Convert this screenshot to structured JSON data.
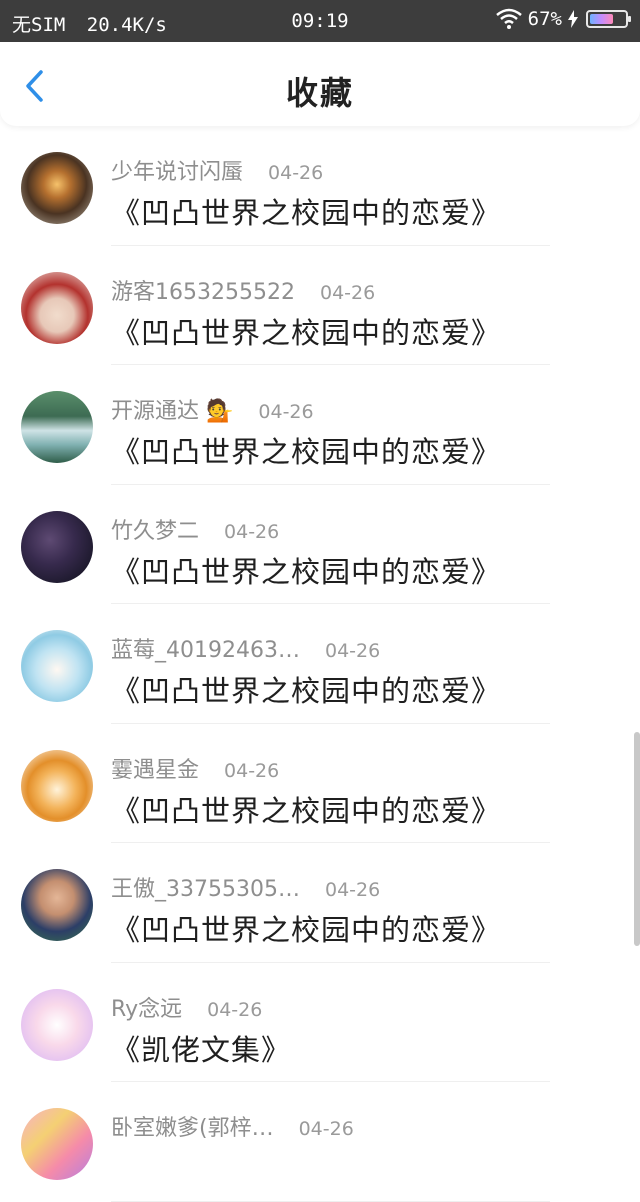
{
  "status_bar": {
    "carrier": "无SIM",
    "speed": "20.4K/s",
    "time": "09:19",
    "battery_percent": "67%",
    "battery_level": 0.67,
    "colors": {
      "background": "#3d3d3d",
      "text": "#ffffff"
    }
  },
  "header": {
    "title": "收藏",
    "back_icon": "chevron-left-icon",
    "accent_color": "#2f8fe8"
  },
  "items": [
    {
      "user": "少年说讨闪蜃",
      "date": "04-26",
      "title": "《凹凸世界之校园中的恋爱》",
      "avatar": "lantern"
    },
    {
      "user": "游客1653255522",
      "date": "04-26",
      "title": "《凹凸世界之校园中的恋爱》",
      "avatar": "red-hair"
    },
    {
      "user": "开源通达 💁",
      "date": "04-26",
      "title": "《凹凸世界之校园中的恋爱》",
      "avatar": "waterfall"
    },
    {
      "user": "竹久梦二",
      "date": "04-26",
      "title": "《凹凸世界之校园中的恋爱》",
      "avatar": "night-sky"
    },
    {
      "user": "蓝莓_40192463…",
      "date": "04-26",
      "title": "《凹凸世界之校园中的恋爱》",
      "avatar": "anime-blue"
    },
    {
      "user": "霎遇星金",
      "date": "04-26",
      "title": "《凹凸世界之校园中的恋爱》",
      "avatar": "fox-boy"
    },
    {
      "user": "王傲_33755305…",
      "date": "04-26",
      "title": "《凹凸世界之校园中的恋爱》",
      "avatar": "photo-person"
    },
    {
      "user": "Ry念远",
      "date": "04-26",
      "title": "《凯佬文集》",
      "avatar": "pink-anime"
    },
    {
      "user": "卧室嫩爹(郭梓…",
      "date": "04-26",
      "title": "",
      "avatar": "colorful"
    }
  ]
}
